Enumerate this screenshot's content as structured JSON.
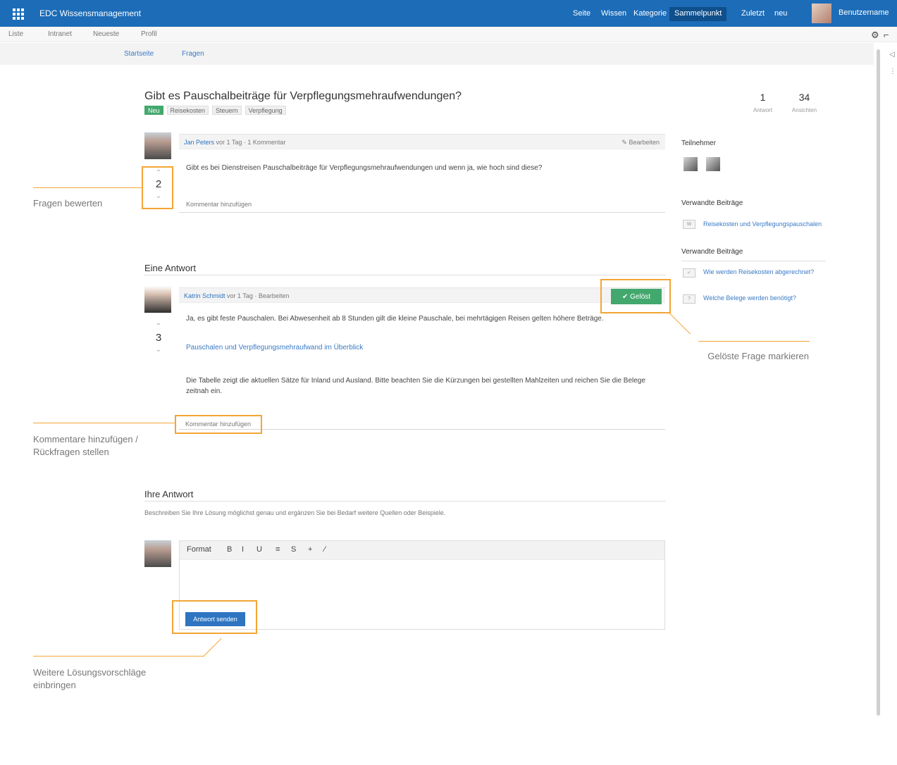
{
  "topbar": {
    "brand": "EDC Wissensmanagement",
    "nav": [
      "Seite",
      "Wissen",
      "Kategorie",
      "Sammelpunkt",
      "Zuletzt",
      "neu"
    ],
    "active_nav": "Sammelpunkt",
    "user": "Benutzername"
  },
  "subnav": {
    "items": [
      "Liste",
      "Intranet",
      "Neueste",
      "Profil"
    ]
  },
  "toolbar": {
    "settings": "⚙",
    "bookmark": "⌐"
  },
  "breadcrumb": [
    "Startseite",
    "Fragen"
  ],
  "question": {
    "title": "Gibt es Pauschalbeiträge für Verpflegungsmehraufwendungen?",
    "tags": [
      {
        "label": "Neu",
        "color": "#43a86d"
      },
      {
        "label": "Reisekosten",
        "color": "#efefef"
      },
      {
        "label": "Steuern",
        "color": "#efefef"
      },
      {
        "label": "Verpflegung",
        "color": "#efefef"
      }
    ],
    "stats": [
      {
        "value": "1",
        "label": "Antwort"
      },
      {
        "value": "34",
        "label": "Ansichten"
      }
    ],
    "author": "Jan Peters",
    "meta": "vor 1 Tag · 1 Kommentar",
    "edit_label": "✎ Bearbeiten",
    "body": "Gibt es bei Dienstreisen Pauschalbeiträge für Verpflegungsmehraufwendungen und wenn ja, wie hoch sind diese?",
    "votes": "2",
    "comment_link": "Kommentar hinzufügen"
  },
  "answer": {
    "heading": "Eine Antwort",
    "author": "Katrin Schmidt",
    "meta": "vor 1 Tag · Bearbeiten",
    "accept_label": "✔ Gelöst",
    "paragraph1": "Ja, es gibt feste Pauschalen. Bei Abwesenheit ab 8 Stunden gilt die kleine Pauschale, bei mehrtägigen Reisen gelten höhere Beträge.",
    "link": "Pauschalen und Verpflegungsmehraufwand im Überblick",
    "paragraph2": "Die Tabelle zeigt die aktuellen Sätze für Inland und Ausland. Bitte beachten Sie die Kürzungen bei gestellten Mahlzeiten und reichen Sie die Belege zeitnah ein.",
    "votes": "3",
    "comment_link": "Kommentar hinzufügen"
  },
  "your_answer": {
    "heading": "Ihre Antwort",
    "intro": "Beschreiben Sie Ihre Lösung möglichst genau und ergänzen Sie bei Bedarf weitere Quellen oder Beispiele.",
    "editor_tools": [
      "Format",
      "B",
      "I",
      "U",
      "≡",
      "S",
      "+",
      "∕"
    ],
    "submit_label": "Antwort senden"
  },
  "right_panel": {
    "participants_heading": "Teilnehmer",
    "related_heading": "Verwandte Beiträge",
    "related_item": "Reisekosten und Verpflegungspauschalen",
    "similar_heading": "Verwandte Beiträge",
    "similar_items": [
      "Wie werden Reisekosten abgerechnet?",
      "Welche Belege werden benötigt?"
    ]
  },
  "callouts": {
    "rate_questions": "Fragen bewerten",
    "mark_solved": "Gelöste Frage markieren",
    "add_comments": "Kommentare hinzufügen / Rückfragen stellen",
    "contribute": "Weitere Lösungsvorschläge einbringen"
  },
  "colors": {
    "top_blue": "#1c6cb8",
    "accent_orange": "#f4a534",
    "success_green": "#43a86d",
    "link_blue": "#3a7ac6"
  }
}
